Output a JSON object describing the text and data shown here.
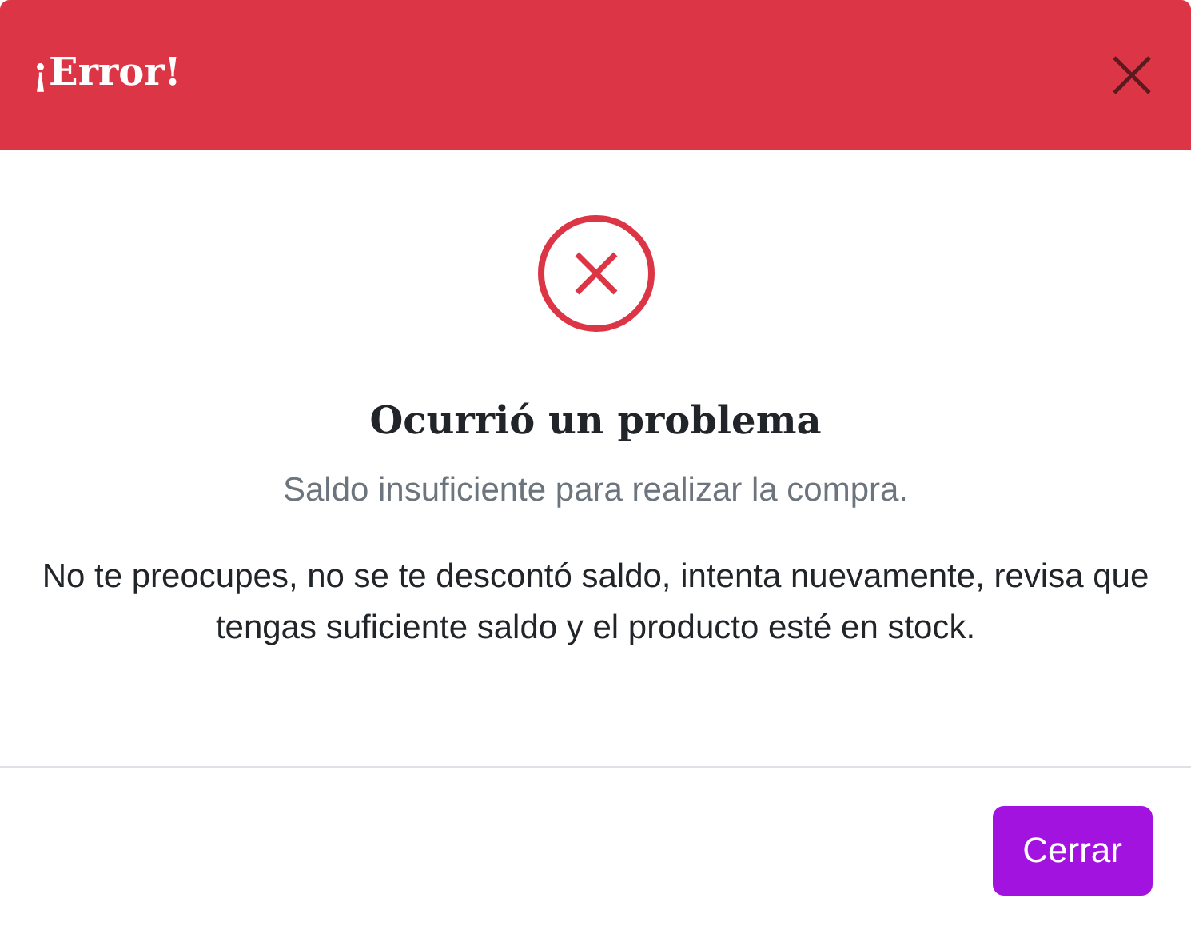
{
  "dialog": {
    "title": "¡Error!",
    "heading": "Ocurrió un problema",
    "subtitle": "Saldo insuficiente para realizar la compra.",
    "message": "No te preocupes, no se te descontó saldo, intenta nuevamente, revisa que tengas suficiente saldo y el producto esté en stock.",
    "buttons": [
      {
        "label": "Cerrar",
        "kind": "primary"
      }
    ]
  }
}
